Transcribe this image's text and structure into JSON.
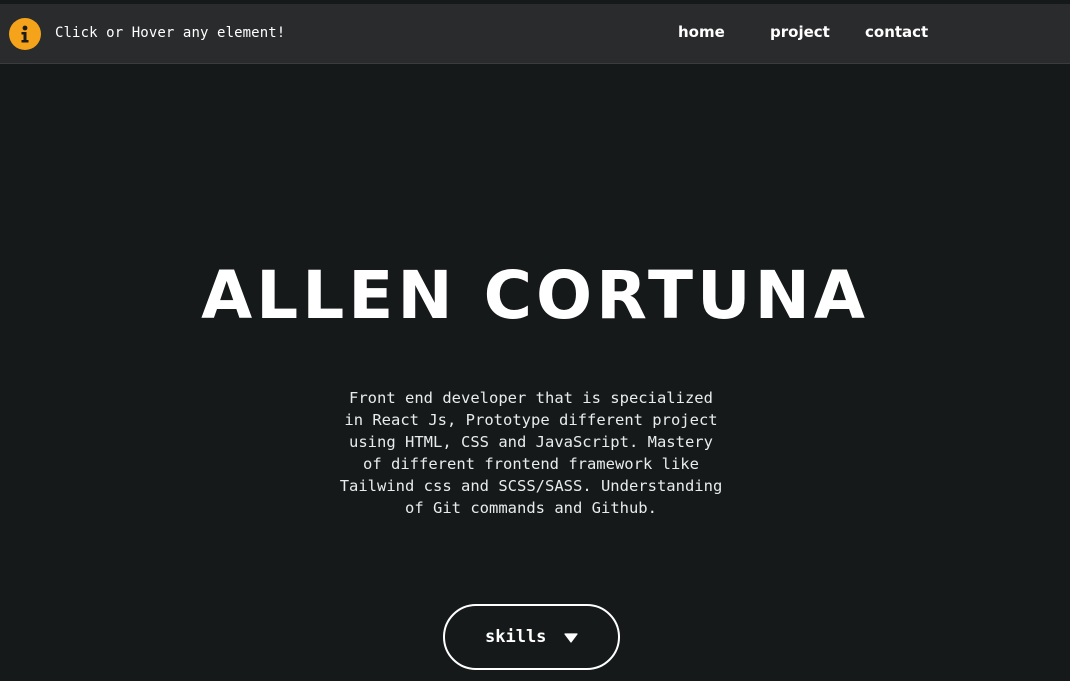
{
  "header": {
    "hint_text": "Click or Hover any element!",
    "info_icon": "info-circle-icon",
    "nav": [
      {
        "label": "home"
      },
      {
        "label": "project"
      },
      {
        "label": "contact"
      }
    ]
  },
  "hero": {
    "name": "ALLEN CORTUNA",
    "description_lines": [
      "Front end developer that is specialized",
      "in React Js, Prototype different project",
      "using HTML, CSS and JavaScript. Mastery",
      "of different frontend framework like",
      "Tailwind css and SCSS/SASS. Understanding",
      "of Git commands and Github."
    ],
    "skills_button": {
      "label": "skills",
      "icon": "caret-down-icon"
    }
  },
  "colors": {
    "background": "#151919",
    "navbar": "#2a2b2d",
    "accent": "#f5a31a",
    "text": "#ffffff"
  }
}
